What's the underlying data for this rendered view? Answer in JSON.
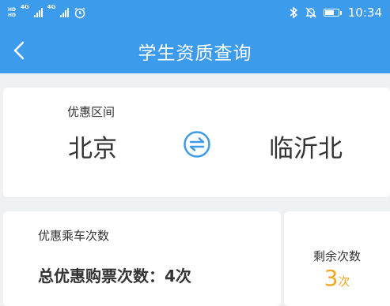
{
  "status_bar": {
    "hd_label": "HD",
    "network_1": "4G",
    "network_2": "4G",
    "time": "10:34",
    "icons": [
      "hd-icon",
      "signal-icon",
      "alarm-icon",
      "bluetooth-icon",
      "mute-icon",
      "battery-icon"
    ]
  },
  "header": {
    "title": "学生资质查询",
    "background_color": "#3d9bec"
  },
  "route": {
    "caption": "优惠区间",
    "from": "北京",
    "to": "临沂北",
    "swap_icon": "swap-icon"
  },
  "ride_counts": {
    "caption": "优惠乘车次数",
    "total_label": "总优惠购票次数：",
    "total_value": "4次"
  },
  "remaining": {
    "label": "剩余次数",
    "value": "3",
    "unit": "次",
    "color": "#f5a623"
  }
}
